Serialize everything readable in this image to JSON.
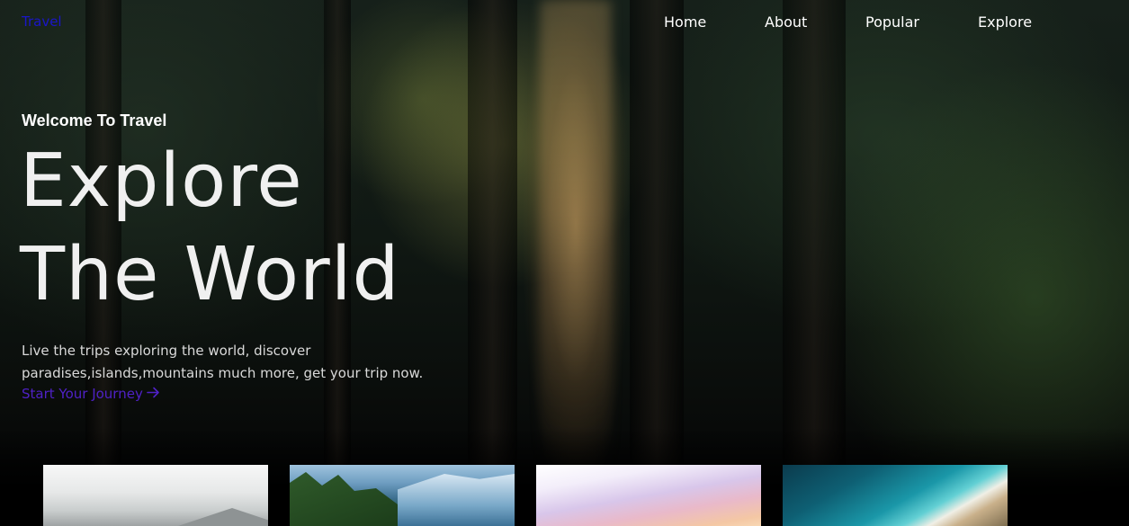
{
  "header": {
    "logo": "Travel",
    "nav": [
      {
        "label": "Home"
      },
      {
        "label": "About"
      },
      {
        "label": "Popular"
      },
      {
        "label": "Explore"
      }
    ]
  },
  "hero": {
    "welcome": "Welcome To Travel",
    "headline_line1": "Explore",
    "headline_line2": "The World",
    "description": "Live the trips exploring the world, discover paradises,islands,mountains much more, get your trip now.",
    "cta_label": "Start Your Journey",
    "cta_icon": "arrow-right-icon"
  },
  "colors": {
    "logo": "#1a16c8",
    "cta": "#4f21c6",
    "nav_text": "#ffffff"
  },
  "cards": [
    {
      "scene": "misty-mountains"
    },
    {
      "scene": "alpine-valley"
    },
    {
      "scene": "pastel-sky"
    },
    {
      "scene": "aerial-beach"
    }
  ]
}
